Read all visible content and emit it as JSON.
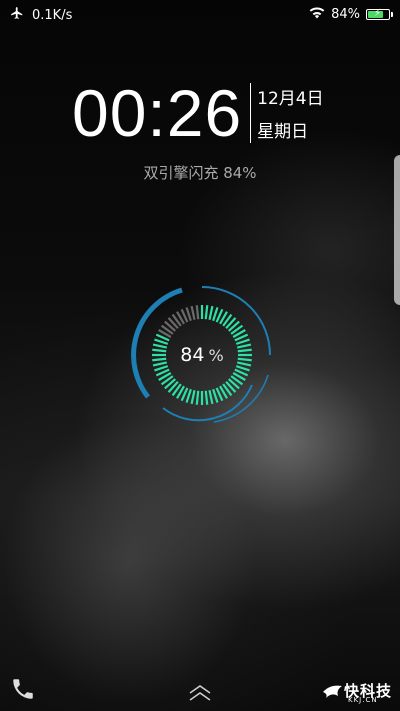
{
  "status_bar": {
    "network_speed": "0.1K/s",
    "battery_percent": "84%",
    "battery_level": 0.84,
    "icons": [
      "airplane-mode-icon",
      "wifi-icon",
      "battery-charging-icon"
    ]
  },
  "lock_screen": {
    "time": "00:26",
    "date": "12月4日",
    "weekday": "星期日",
    "charge_status": "双引擎闪充 84%",
    "charge_ring_percent_value": "84",
    "charge_ring_percent_unit": "%",
    "charge_level": 0.84
  },
  "colors": {
    "ring_green": "#2ee0a3",
    "ring_blue": "#1d7fb3",
    "battery_green": "#4cd964"
  },
  "bottom_bar": {
    "icons": [
      "phone-icon",
      "swipe-up-icon"
    ],
    "watermark_text": "快科技",
    "watermark_sub": "KKJ.CN"
  }
}
